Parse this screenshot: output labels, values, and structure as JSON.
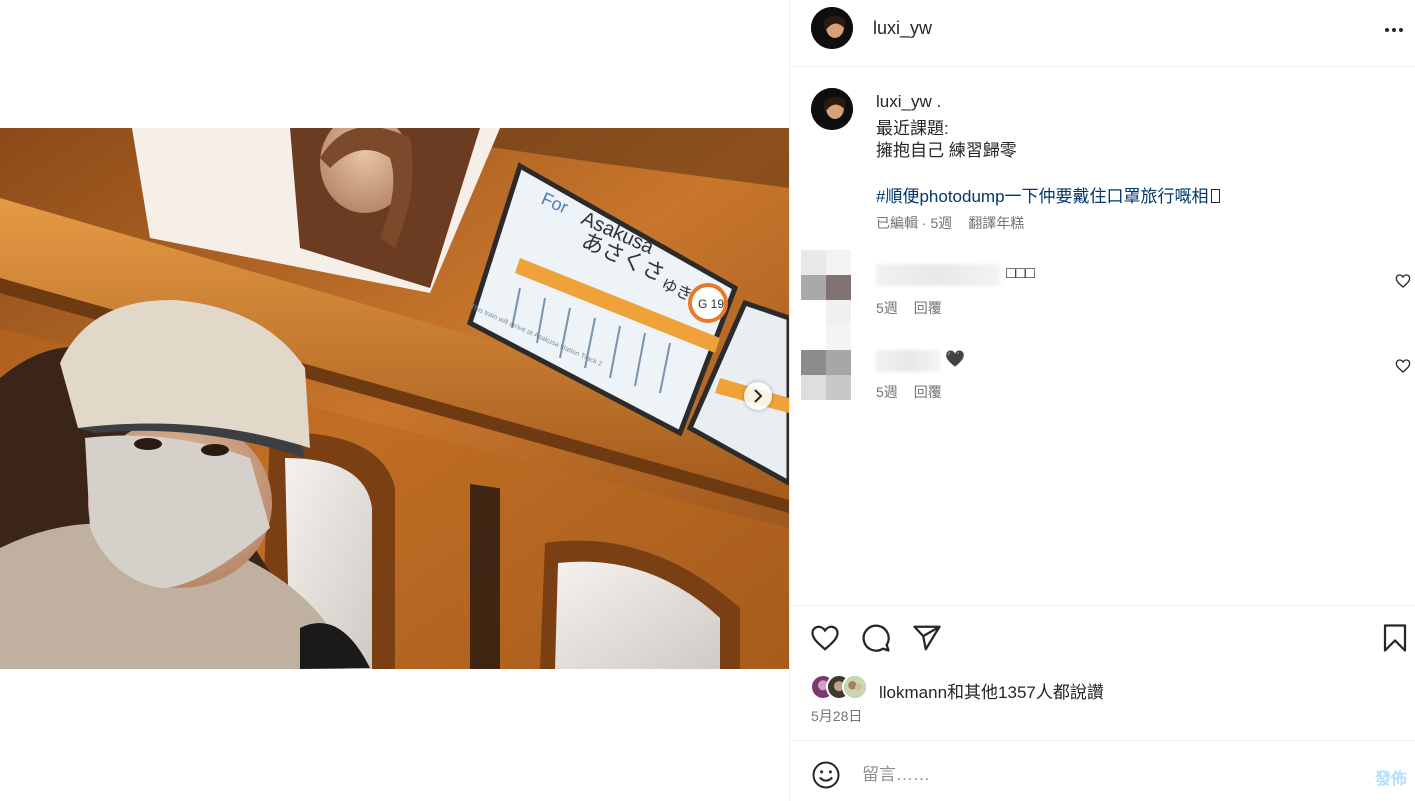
{
  "header": {
    "username": "luxi_yw"
  },
  "caption": {
    "username": "luxi_yw",
    "suffix": " .",
    "lines": [
      "最近課題:",
      "擁抱自己 練習歸零"
    ],
    "hashtag": "#順便photodump一下仲要戴住口罩旅行嘅相",
    "edited": "已編輯",
    "age": "5週",
    "translate": "翻譯年糕"
  },
  "comments": [
    {
      "text": "□□□",
      "age": "5週",
      "reply": "回覆"
    },
    {
      "text": "🖤",
      "age": "5週",
      "reply": "回覆"
    }
  ],
  "likes": {
    "user": "llokmann",
    "rest": "和其他1357人都說讚"
  },
  "date": "5月28日",
  "comment_input": {
    "placeholder": "留言……",
    "post_label": "發佈"
  },
  "photo": {
    "sign_for": "For",
    "sign_dest": "Asakusa",
    "sign_kana": "あさくさ",
    "sign_yuki": "ゆき",
    "sign_code": "G 19",
    "sign_foot": "This train will arrive at Asakusa station Track 2"
  },
  "colors": {
    "link": "#00376b",
    "muted": "#737373",
    "post_disabled": "#b2dffc",
    "divider": "#efefef"
  },
  "icons": [
    "more-icon",
    "heart-icon",
    "comment-icon",
    "share-icon",
    "bookmark-icon",
    "emoji-icon",
    "chevron-right-icon"
  ]
}
